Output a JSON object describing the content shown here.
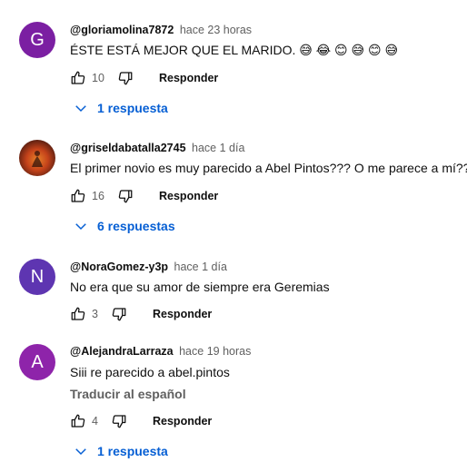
{
  "comments": [
    {
      "avatar_letter": "G",
      "avatar_color": "#7b1fa2",
      "author": "@gloriamolina7872",
      "time": "hace 23 horas",
      "text": "ÉSTE  ESTÁ  MEJOR QUE EL  MARIDO. 😅 😂 😊 😅 😊 😅",
      "likes": "10",
      "reply_label": "Responder",
      "replies_label": "1 respuesta"
    },
    {
      "avatar_letter": "",
      "avatar_color": "#8d3a1a",
      "author": "@griseldabatalla2745",
      "time": "hace 1 día",
      "text": "El primer novio es muy parecido a Abel Pintos??? O me parece a mí??",
      "likes": "16",
      "reply_label": "Responder",
      "replies_label": "6 respuestas"
    },
    {
      "avatar_letter": "N",
      "avatar_color": "#5e35b1",
      "author": "@NoraGomez-y3p",
      "time": "hace 1 día",
      "text": "No era que su amor de siempre era Geremias",
      "likes": "3",
      "reply_label": "Responder"
    },
    {
      "avatar_letter": "A",
      "avatar_color": "#8e24aa",
      "author": "@AlejandraLarraza",
      "time": "hace 19 horas",
      "text": "Siii re parecido a abel.pintos",
      "translate_label": "Traducir al español",
      "likes": "4",
      "reply_label": "Responder",
      "replies_label": "1 respuesta"
    }
  ]
}
